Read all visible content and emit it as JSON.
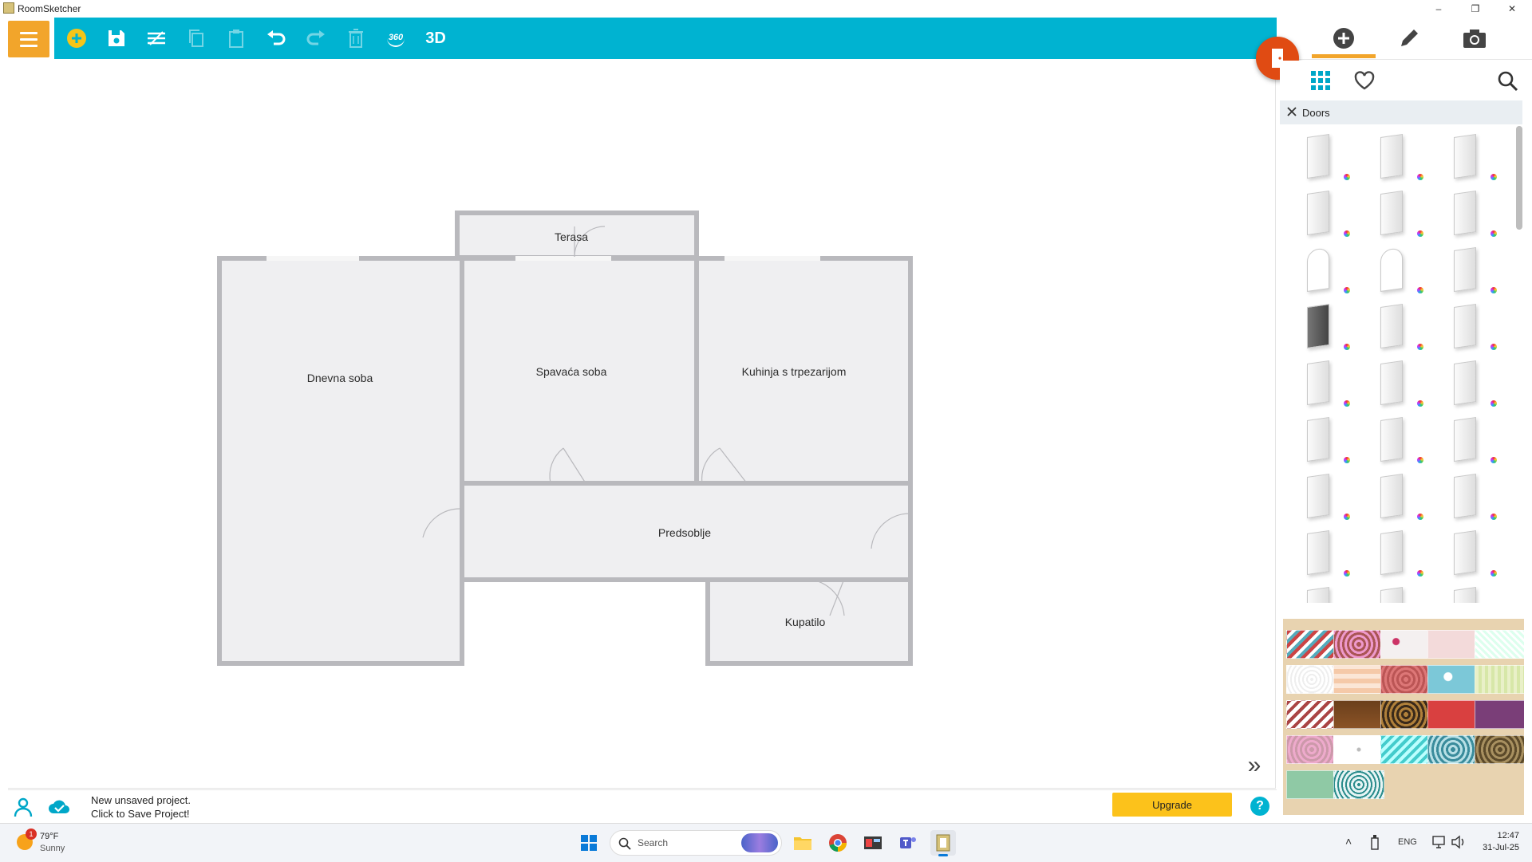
{
  "window": {
    "title": "RoomSketcher",
    "minimize": "–",
    "maximize": "❐",
    "close": "✕"
  },
  "toolbar": {
    "view3d_label": "3D",
    "view360_label": "360"
  },
  "floorplan": {
    "rooms": [
      {
        "id": "terasa",
        "label": "Terasa"
      },
      {
        "id": "dnevna",
        "label": "Dnevna soba"
      },
      {
        "id": "spavaca",
        "label": "Spavaća soba"
      },
      {
        "id": "kuhinja",
        "label": "Kuhinja s trpezarijom"
      },
      {
        "id": "predsoblje",
        "label": "Predsoblje"
      },
      {
        "id": "kupatilo",
        "label": "Kupatilo"
      }
    ]
  },
  "right_panel": {
    "tabs": [
      {
        "icon": "plus-circle-icon"
      },
      {
        "icon": "pencil-icon"
      },
      {
        "icon": "camera-icon"
      }
    ],
    "active_tab": "add",
    "category": {
      "label": "Doors",
      "close_icon": "close-icon"
    },
    "door_item_count": 27
  },
  "status": {
    "line1": "New unsaved project.",
    "line2": "Click to Save Project!",
    "upgrade_label": "Upgrade",
    "help_label": "?"
  },
  "taskbar": {
    "weather_temp": "79°F",
    "weather_desc": "Sunny",
    "weather_badge": "1",
    "search_placeholder": "Search",
    "language": "ENG",
    "time": "12:47",
    "date": "31-Jul-25"
  },
  "colors": {
    "toolbar": "#00b3d1",
    "accent": "#f2a52b",
    "fab": "#e04b13",
    "upgrade": "#fcc21b"
  }
}
